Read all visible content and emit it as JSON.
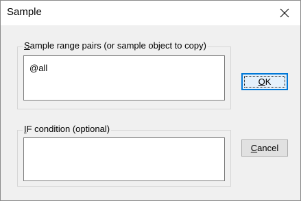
{
  "window": {
    "title": "Sample",
    "close_glyph": "close-icon"
  },
  "range_group": {
    "label_accel": "S",
    "label_rest": "ample range pairs (or sample object to copy)",
    "value": "@all"
  },
  "if_group": {
    "label_accel": "I",
    "label_rest": "F condition (optional)",
    "value": ""
  },
  "buttons": {
    "ok_accel": "O",
    "ok_rest": "K",
    "cancel_accel": "C",
    "cancel_rest": "ancel"
  },
  "colors": {
    "dialog_bg": "#f0f0f0",
    "focus_border": "#0078d7"
  }
}
